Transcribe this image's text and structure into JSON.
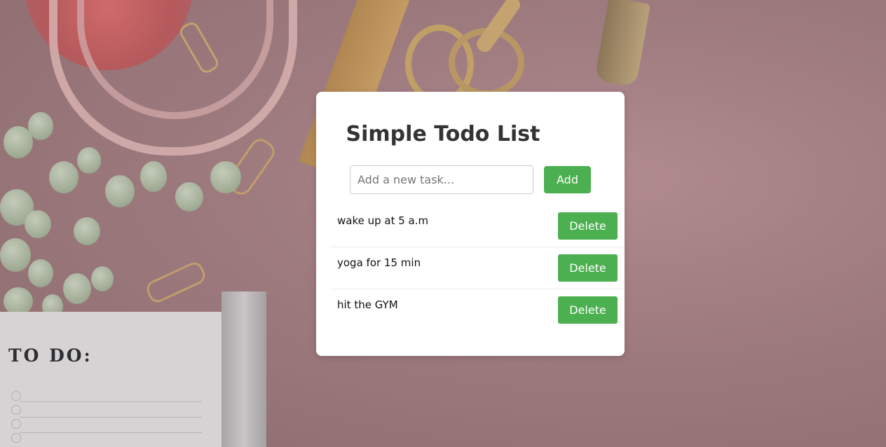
{
  "app": {
    "title": "Simple Todo List"
  },
  "form": {
    "input_value": "",
    "input_placeholder": "Add a new task...",
    "add_label": "Add"
  },
  "tasks": [
    {
      "text": "wake up at 5 a.m",
      "delete_label": "Delete"
    },
    {
      "text": "yoga for 15 min",
      "delete_label": "Delete"
    },
    {
      "text": "hit the GYM",
      "delete_label": "Delete"
    }
  ],
  "background": {
    "note_heading": "TO DO:"
  },
  "colors": {
    "accent": "#4caf50",
    "card": "#ffffff",
    "title": "#333333",
    "background": "#9d7a7e"
  }
}
